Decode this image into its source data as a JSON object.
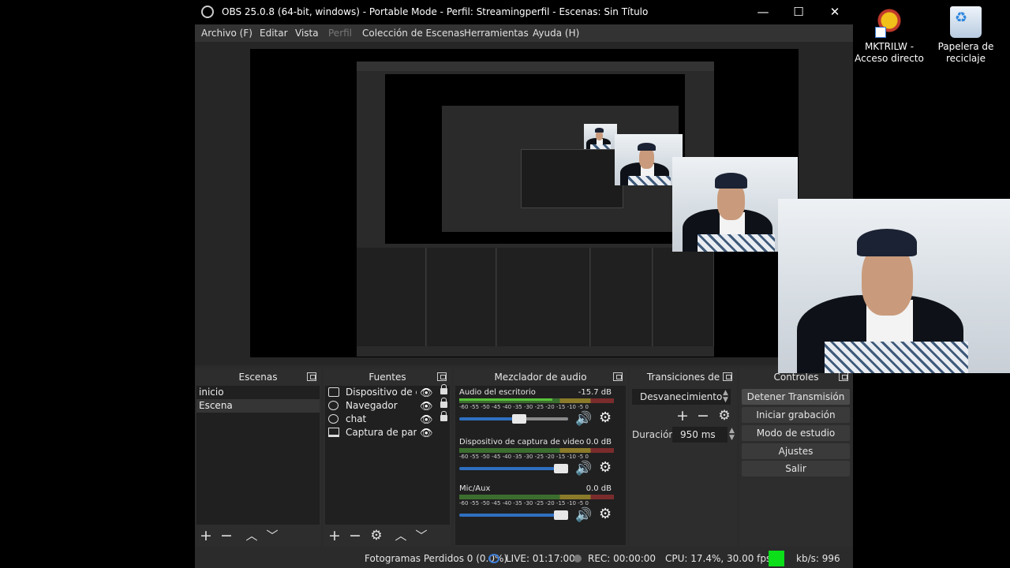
{
  "window": {
    "title": "OBS 25.0.8 (64-bit, windows) - Portable Mode - Perfil: Streamingperfil - Escenas: Sin Título",
    "controls": {
      "minimize": "—",
      "maximize": "☐",
      "close": "✕"
    }
  },
  "menu": {
    "items": [
      {
        "label": "Archivo (F)"
      },
      {
        "label": "Editar"
      },
      {
        "label": "Vista"
      },
      {
        "label": "Perfil"
      },
      {
        "label": "Colección de Escenas"
      },
      {
        "label": "Herramientas"
      },
      {
        "label": "Ayuda (H)"
      }
    ]
  },
  "desktop": {
    "icons": [
      {
        "label": "MKTRILW - Acceso directo",
        "icon": "mk-shortcut-icon"
      },
      {
        "label": "Papelera de reciclaje",
        "icon": "recycle-bin-icon"
      }
    ]
  },
  "scenes": {
    "title": "Escenas",
    "items": [
      {
        "label": "inicio"
      },
      {
        "label": "Escena"
      }
    ]
  },
  "sources": {
    "title": "Fuentes",
    "items": [
      {
        "label": "Dispositivo de cap",
        "icon": "camera-icon"
      },
      {
        "label": "Navegador",
        "icon": "globe-icon"
      },
      {
        "label": "chat",
        "icon": "globe-icon"
      },
      {
        "label": "Captura de pantal",
        "icon": "monitor-icon"
      }
    ]
  },
  "mixer": {
    "title": "Mezclador de audio",
    "scale": "-60 -55 -50 -45 -40 -35 -30 -25 -20 -15 -10 -5 0",
    "channels": [
      {
        "name": "Audio del escritorio",
        "db": "-15.7 dB",
        "level": 0.6,
        "volume": 0.55
      },
      {
        "name": "Dispositivo de captura de video",
        "db": "0.0 dB",
        "level": 0.0,
        "volume": 1.0
      },
      {
        "name": "Mic/Aux",
        "db": "0.0 dB",
        "level": 0.0,
        "volume": 1.0
      }
    ]
  },
  "transitions": {
    "title": "Transiciones de escena",
    "selected": "Desvanecimiento",
    "duration_label": "Duración",
    "duration_value": "950 ms"
  },
  "controls": {
    "title": "Controles",
    "buttons": [
      {
        "label": "Detener Transmisión"
      },
      {
        "label": "Iniciar grabación"
      },
      {
        "label": "Modo de estudio"
      },
      {
        "label": "Ajustes"
      },
      {
        "label": "Salir"
      }
    ]
  },
  "status": {
    "dropped_frames": "Fotogramas Perdidos 0 (0.0%)",
    "live": "LIVE: 01:17:00",
    "rec": "REC: 00:00:00",
    "cpu": "CPU: 17.4%, 30.00 fps",
    "kbps": "kb/s: 996",
    "indicator_color": "#0cde1a"
  }
}
